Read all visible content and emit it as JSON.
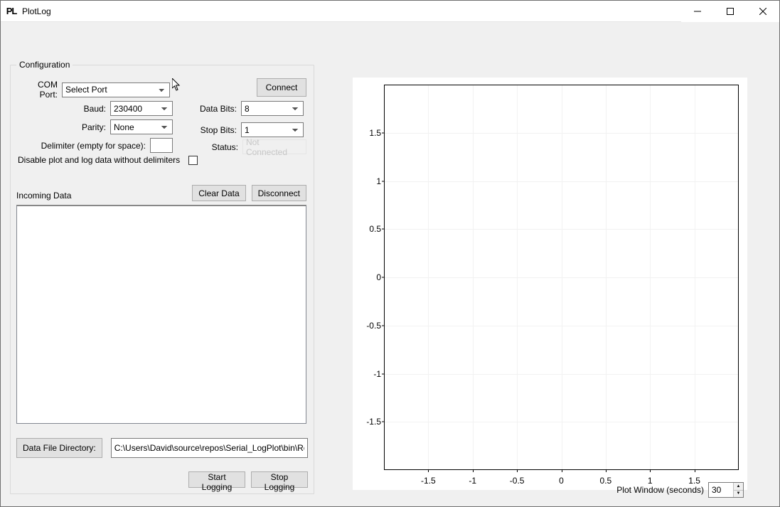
{
  "app": {
    "title": "PlotLog",
    "icon_text": "PL"
  },
  "groupbox": {
    "title": "Configuration"
  },
  "labels": {
    "com_port": "COM Port:",
    "baud": "Baud:",
    "parity": "Parity:",
    "delimiter": "Delimiter (empty for space):",
    "disable_plot": "Disable plot and log data without delimiters",
    "data_bits": "Data Bits:",
    "stop_bits": "Stop Bits:",
    "status": "Status:",
    "incoming": "Incoming Data",
    "data_file_dir": "Data File Directory:",
    "plot_window": "Plot Window (seconds)"
  },
  "values": {
    "com_port": "Select Port",
    "baud": "230400",
    "parity": "None",
    "delimiter": "",
    "data_bits": "8",
    "stop_bits": "1",
    "status": "Not Connected",
    "file_dir": "C:\\Users\\David\\source\\repos\\Serial_LogPlot\\bin\\Release\\",
    "plot_window_seconds": "30"
  },
  "buttons": {
    "connect": "Connect",
    "clear_data": "Clear Data",
    "disconnect": "Disconnect",
    "start_logging": "Start Logging",
    "stop_logging": "Stop Logging"
  },
  "chart_data": {
    "type": "line",
    "series": [],
    "x_ticks": [
      "-1.5",
      "-1",
      "-0.5",
      "0",
      "0.5",
      "1",
      "1.5"
    ],
    "y_ticks": [
      "1.5",
      "1",
      "0.5",
      "0",
      "-0.5",
      "-1",
      "-1.5"
    ],
    "xlim": [
      -2,
      2
    ],
    "ylim": [
      -2,
      2
    ],
    "title": "",
    "xlabel": "",
    "ylabel": ""
  }
}
